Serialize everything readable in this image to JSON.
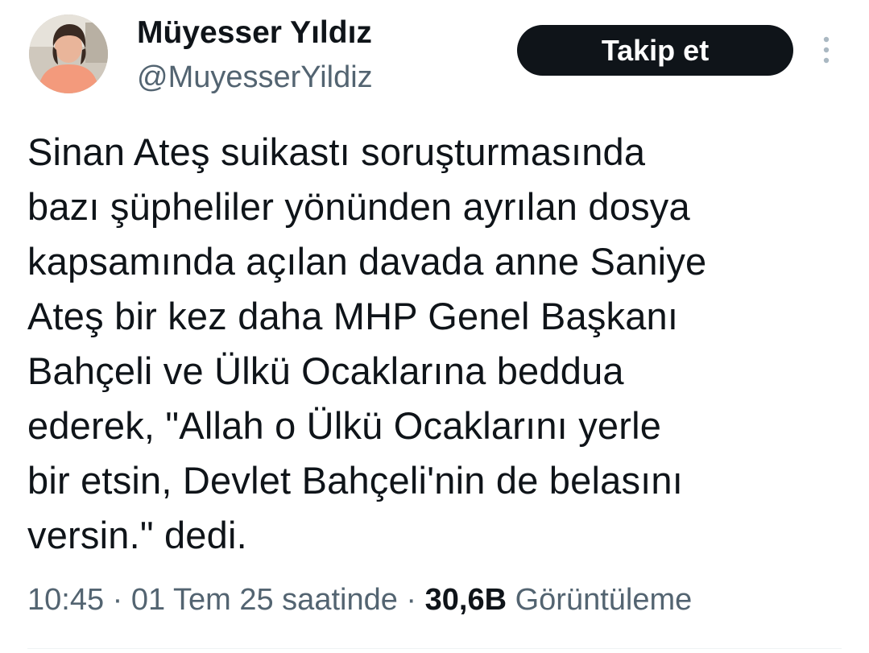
{
  "author": {
    "display_name": "Müyesser Yıldız",
    "handle": "@MuyesserYildiz",
    "avatar_icon": "profile-photo"
  },
  "actions": {
    "follow_label": "Takip et",
    "more_icon": "more-vertical-icon"
  },
  "tweet": {
    "text": "Sinan Ateş suikastı soruşturmasında\nbazı şüpheliler yönünden ayrılan dosya\nkapsamında açılan davada anne Saniye\nAteş bir kez daha MHP Genel Başkanı\nBahçeli ve Ülkü Ocaklarına beddua\nederek, \"Allah o Ülkü Ocaklarını yerle\nbir etsin, Devlet Bahçeli'nin de belasını\nversin.\" dedi.",
    "time": "10:45",
    "separator": "·",
    "date": "01 Tem 25 saatinde",
    "views_count": "30,6B",
    "views_label": "Görüntüleme"
  },
  "colors": {
    "text_primary": "#0f1419",
    "text_secondary": "#536471",
    "button_bg": "#0f1419",
    "button_text": "#ffffff",
    "avatar_shirt": "#f39a7c"
  }
}
